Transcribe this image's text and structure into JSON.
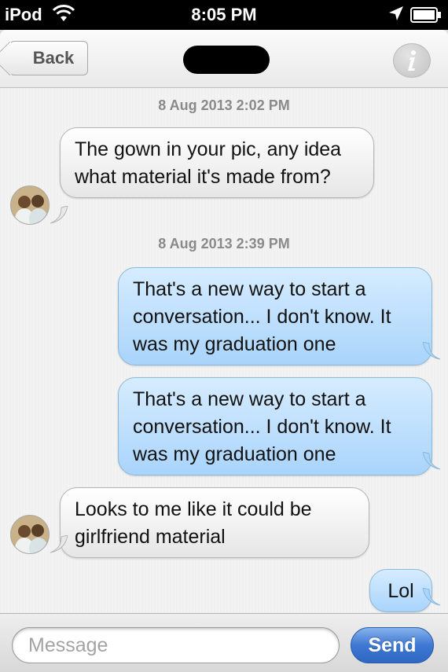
{
  "status_bar": {
    "carrier": "iPod",
    "time": "8:05 PM",
    "wifi_icon": "wifi-icon",
    "location_icon": "location-arrow-icon",
    "battery_icon": "battery-icon"
  },
  "nav": {
    "back_label": "Back",
    "contact_name": "",
    "info_icon": "info-icon"
  },
  "messages": {
    "timestamp_1": "8 Aug 2013 2:02 PM",
    "msg_1": "The gown in your pic, any idea what material it's made from?",
    "timestamp_2": "8 Aug 2013 2:39 PM",
    "msg_2": "That's a new way to start a conversation... I don't know. It was my graduation one",
    "msg_3": "That's a new way to start a conversation... I don't know. It was my graduation one",
    "msg_4": "Looks to me like it could be girlfriend material",
    "msg_5": "Lol"
  },
  "compose": {
    "placeholder": "Message",
    "send_label": "Send"
  },
  "colors": {
    "incoming_bubble": "#e9e9e9",
    "outgoing_bubble": "#b8dcfb",
    "send_button": "#3e78d2"
  }
}
